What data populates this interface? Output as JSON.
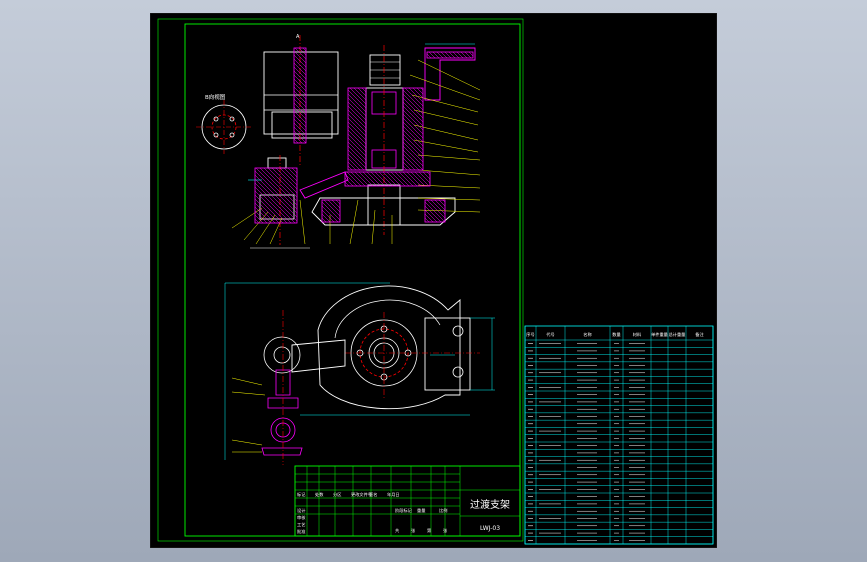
{
  "app": {
    "viewport_background": "#000000",
    "page_background": "#b0b9c8"
  },
  "colors": {
    "frame": "#00ff00",
    "geometry": "#ffffff",
    "section_hatch": "#ff00ff",
    "center_line": "#ff0000",
    "dimension": "#00ffff",
    "leader": "#ffff00",
    "annotation": "#ffffff"
  },
  "drawing": {
    "title_block": {
      "drawing_title": "过渡支架",
      "drawing_code": "LWJ-03",
      "row_headers": [
        "标记",
        "处数",
        "分区",
        "更改文件号",
        "签名",
        "年月日"
      ],
      "approval_labels": [
        "设计",
        "审核",
        "工艺",
        "批准"
      ],
      "info_labels": [
        "阶段标记",
        "重量",
        "比例"
      ],
      "footer_labels": [
        "共",
        "张",
        "第",
        "张"
      ]
    },
    "detail_label": "B向视图",
    "bom_header": [
      "序号",
      "代号",
      "名称",
      "数量",
      "材料",
      "单件重量",
      "总计重量",
      "备注"
    ]
  }
}
